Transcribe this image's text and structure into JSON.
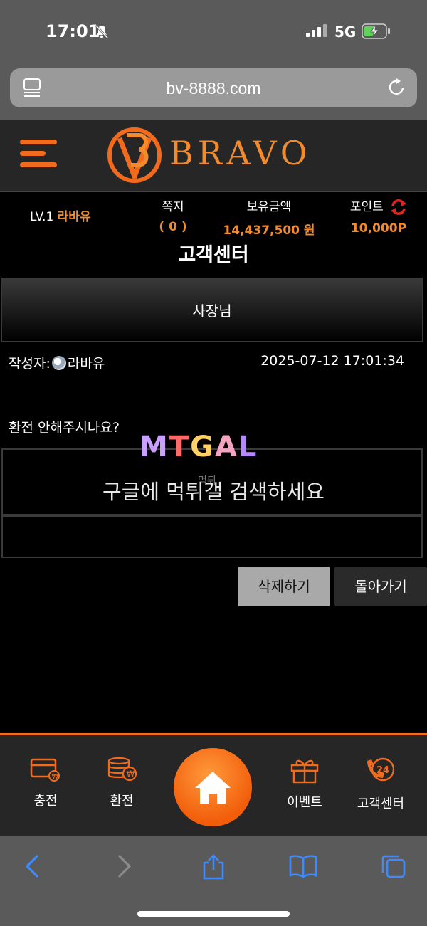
{
  "status": {
    "time": "17:01",
    "network": "5G"
  },
  "browser": {
    "url": "bv-8888.com"
  },
  "site": {
    "logo_text": "BRAVO"
  },
  "user": {
    "level": "LV.1",
    "name": "라바유",
    "notes_label": "쪽지",
    "notes_value": "( 0 )",
    "balance_label": "보유금액",
    "balance_value": "14,437,500 원",
    "points_label": "포인트",
    "points_value": "10,000P"
  },
  "page": {
    "title": "고객센터"
  },
  "post": {
    "title": "사장님",
    "author_label": "작성자:",
    "author": "라바유",
    "date": "2025-07-12 17:01:34",
    "body": "환전 안해주시나요?"
  },
  "watermark": {
    "logo": "MTGAL",
    "sub": "먹튀",
    "text": "구글에 먹튀갤 검색하세요"
  },
  "buttons": {
    "delete": "삭제하기",
    "back": "돌아가기"
  },
  "nav": {
    "charge": "충전",
    "exchange": "환전",
    "event": "이벤트",
    "support": "고객센터"
  },
  "colors": {
    "accent": "#f26a1b",
    "header_bg": "#262626"
  }
}
